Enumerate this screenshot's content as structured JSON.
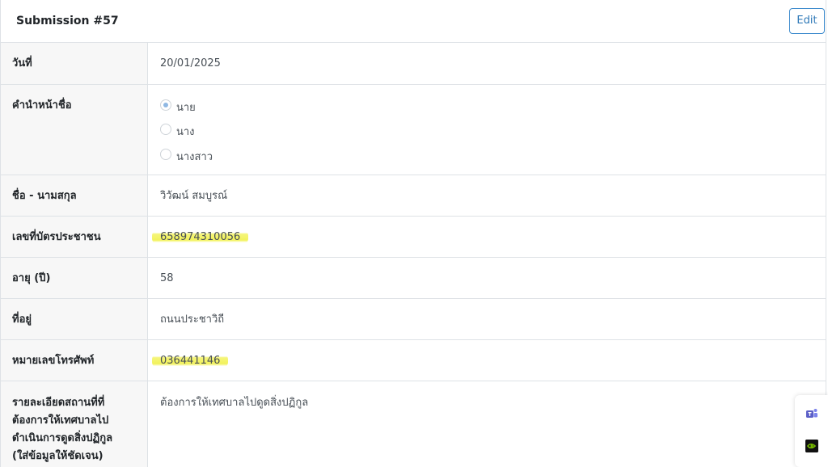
{
  "header": {
    "title": "Submission #57",
    "edit_label": "Edit"
  },
  "rows": {
    "date": {
      "label": "วันที่",
      "value": "20/01/2025"
    },
    "prefix": {
      "label": "คำนำหน้าชื่อ",
      "options": [
        "นาย",
        "นาง",
        "นางสาว"
      ],
      "selected": "นาย"
    },
    "name": {
      "label": "ชื่อ - นามสกุล",
      "value": "วิวัฒน์ สมบูรณ์"
    },
    "id_card": {
      "label": "เลขที่บัตรประชาชน",
      "value": "658974310056"
    },
    "age": {
      "label": "อายุ (ปี)",
      "value": "58"
    },
    "address": {
      "label": "ที่อยู่",
      "value": "ถนนประชาวิถี"
    },
    "phone": {
      "label": "หมายเลขโทรศัพท์",
      "value": "036441146"
    },
    "details": {
      "label_lines": [
        "รายละเอียดสถานที่ที่",
        "ต้องการให้เทศบาลไป",
        "ดำเนินการดูดสิ่งปฏิกูล",
        "(ใส่ข้อมูลให้ชัดเจน)"
      ],
      "value": "ต้องการให้เทศบาลไปดูดสิ่งปฏิกูล"
    }
  },
  "icons": {
    "teams": "teams-icon",
    "nvidia": "nvidia-icon"
  },
  "colors": {
    "highlight": "#f2f25c",
    "edit_border": "#3d8bcd",
    "label_bg": "#f7f7f7"
  }
}
